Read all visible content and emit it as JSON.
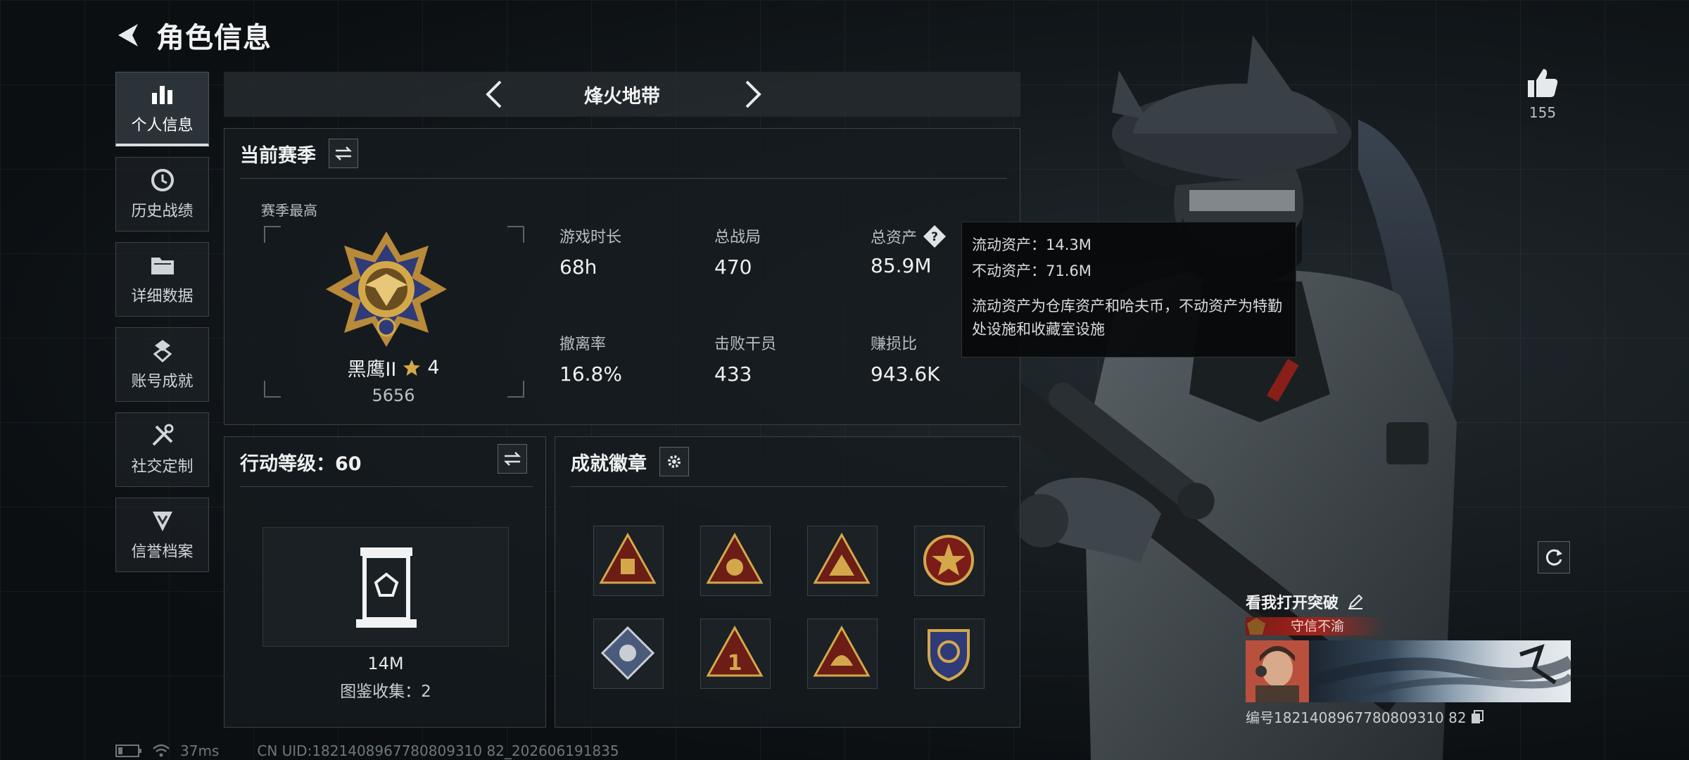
{
  "header": {
    "title": "角色信息"
  },
  "nav": [
    {
      "label": "个人信息",
      "icon": "bar-chart-icon",
      "active": true
    },
    {
      "label": "历史战绩",
      "icon": "clock-icon"
    },
    {
      "label": "详细数据",
      "icon": "folder-icon"
    },
    {
      "label": "账号成就",
      "icon": "achievement-icon"
    },
    {
      "label": "社交定制",
      "icon": "tools-icon"
    },
    {
      "label": "信誉档案",
      "icon": "shield-icon"
    }
  ],
  "map": {
    "title": "烽火地带"
  },
  "season": {
    "title": "当前赛季",
    "best_label": "赛季最高",
    "rank_name": "黑鹰II",
    "rank_stars": "4",
    "rank_score": "5656",
    "stats": [
      {
        "label": "游戏时长",
        "value": "68h"
      },
      {
        "label": "总战局",
        "value": "470"
      },
      {
        "label": "总资产",
        "value": "85.9M"
      },
      {
        "label": "撤离率",
        "value": "16.8%"
      },
      {
        "label": "击败干员",
        "value": "433"
      },
      {
        "label": "赚损比",
        "value": "943.6K"
      }
    ]
  },
  "tooltip": {
    "line1": "流动资产：14.3M",
    "line2": "不动资产：71.6M",
    "desc": "流动资产为仓库资产和哈夫币，不动资产为特勤处设施和收藏室设施"
  },
  "action": {
    "title": "行动等级：60",
    "value": "14M",
    "collect": "图鉴收集：2"
  },
  "badges": {
    "title": "成就徽章"
  },
  "like": {
    "count": "155"
  },
  "card": {
    "name": "看我打开突破",
    "tag": "守信不渝",
    "id": "编号1821408967780809310 82"
  },
  "status": {
    "ping": "37ms",
    "uid": "CN UID:1821408967780809310 82_202606191835"
  },
  "colors": {
    "accent": "#d4a84a",
    "tag_red": "#a0241d"
  }
}
